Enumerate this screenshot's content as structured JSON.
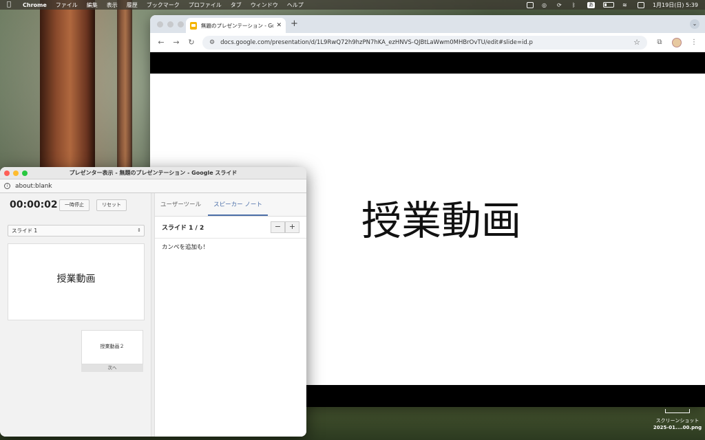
{
  "menubar": {
    "app_name": "Chrome",
    "menus": [
      "ファイル",
      "編集",
      "表示",
      "履歴",
      "ブックマーク",
      "プロファイル",
      "タブ",
      "ウィンドウ",
      "ヘルプ"
    ],
    "ime_label": "あ",
    "clock": "1月19日(日) 5:39"
  },
  "chrome": {
    "tab_title": "無題のプレゼンテーション - Goo",
    "new_tab_label": "+",
    "url": "docs.google.com/presentation/d/1L9RwQ72h9hzPN7hKA_ezHNVS-QJBtLaWwm0MHBrOvTU/edit#slide=id.p",
    "slide_title": "授業動画"
  },
  "presenter": {
    "window_title": "プレゼンター表示 - 無題のプレゼンテーション - Google スライド",
    "address": "about:blank",
    "timer": "00:00:02",
    "pause_label": "一時停止",
    "reset_label": "リセット",
    "slide_select": "スライド 1",
    "current_thumb_text": "授業動画",
    "next_thumb_text": "授業動画２",
    "next_label": "次へ",
    "tabs": [
      "ユーザーツール",
      "スピーカー ノート"
    ],
    "slide_counter": "スライド 1 / 2",
    "zoom_out": "−",
    "zoom_in": "+",
    "notes": "カンペを追加も！"
  },
  "desktop_file": {
    "name_line1": "スクリーンショット",
    "name_line2": "2025-01....00.png"
  },
  "colors": {
    "accent_tab": "#4a6ea8",
    "slides_icon": "#f4b400",
    "close": "#fe5f57",
    "minimize": "#febc2e",
    "maximize": "#28c840"
  }
}
